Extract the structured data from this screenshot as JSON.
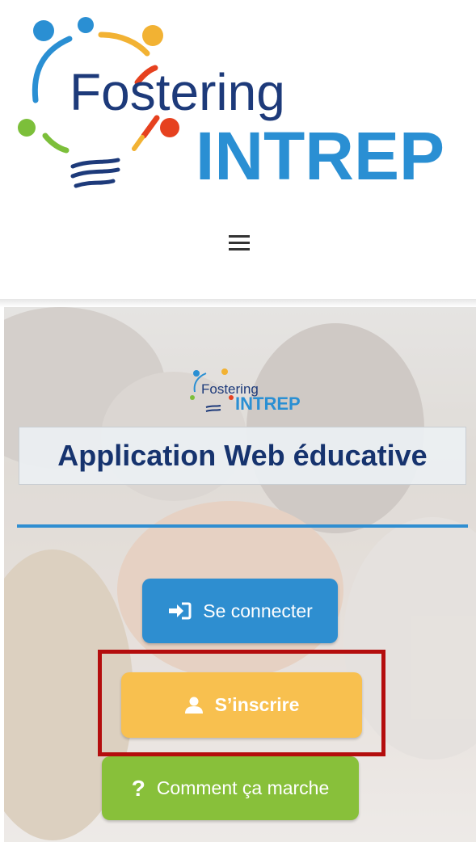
{
  "header": {
    "logo": {
      "line1": "Fostering",
      "line2": "INTREP"
    },
    "menu_icon": "hamburger-menu-icon"
  },
  "hero": {
    "logo_small": {
      "line1": "Fostering",
      "line2": "INTREP"
    },
    "title": "Application Web éducative",
    "buttons": {
      "login": {
        "label": "Se connecter",
        "icon": "sign-in-icon"
      },
      "register": {
        "label": "S’inscrire",
        "icon": "user-icon"
      },
      "help": {
        "label": "Comment ça marche",
        "icon": "question-icon"
      }
    }
  },
  "colors": {
    "brand_blue_dark": "#1d3a7a",
    "brand_blue": "#2a8fd3",
    "title_text": "#16336e",
    "login_button": "#2e8ed0",
    "register_button": "#f8c04f",
    "help_button": "#88c03a",
    "highlight_border": "#b40d0d",
    "divider": "#2f8ed1"
  }
}
